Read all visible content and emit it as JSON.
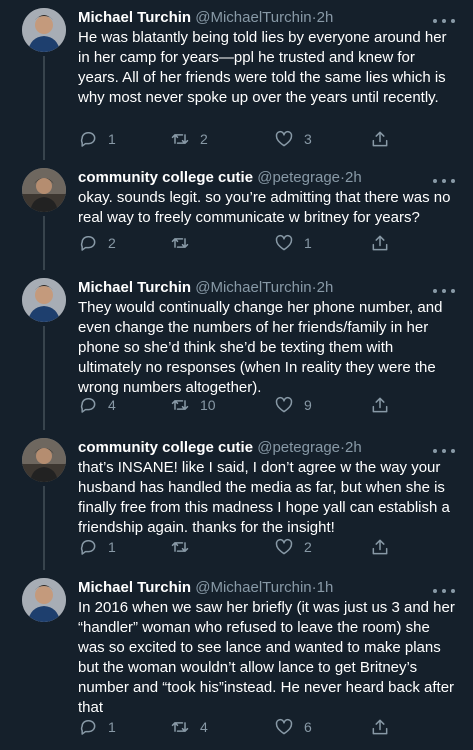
{
  "tweets": [
    {
      "name": "Michael Turchin",
      "handle": "@MichaelTurchin",
      "sep": "·",
      "time": "2h",
      "text": "He was blatantly being told lies by everyone around her in her camp for years—ppl he trusted and knew for years. All of her friends were told the same lies which is why most never spoke up over the years until recently.",
      "replies": "1",
      "retweets": "2",
      "likes": "3"
    },
    {
      "name": "community college cutie",
      "handle": "@petegrage",
      "sep": "·",
      "time": "2h",
      "text": "okay. sounds legit. so you’re admitting that there was no real way to freely communicate w britney for years?",
      "replies": "2",
      "retweets": "",
      "likes": "1"
    },
    {
      "name": "Michael Turchin",
      "handle": "@MichaelTurchin",
      "sep": "·",
      "time": "2h",
      "text": "They would continually change her phone number, and even change the numbers of her friends/family in her phone so she’d think she’d be texting them with ultimately no responses (when In reality they were the wrong numbers altogether).",
      "replies": "4",
      "retweets": "10",
      "likes": "9"
    },
    {
      "name": "community college cutie",
      "handle": "@petegrage",
      "sep": "·",
      "time": "2h",
      "text": "that’s INSANE! like I said, I don’t agree w the way your husband has handled the media as far, but when she is finally free from this madness I hope yall can establish a friendship again. thanks for the insight!",
      "replies": "1",
      "retweets": "",
      "likes": "2"
    },
    {
      "name": "Michael Turchin",
      "handle": "@MichaelTurchin",
      "sep": "·",
      "time": "1h",
      "text": "In 2016 when we saw her briefly (it was just us 3 and her “handler” woman who refused to leave the room) she was so excited to see lance and wanted to make plans but the woman wouldn’t allow lance to get Britney’s number and “took his”instead. He never heard back after that",
      "replies": "1",
      "retweets": "4",
      "likes": "6"
    }
  ],
  "icons": [
    "reply-icon",
    "retweet-icon",
    "like-icon",
    "share-icon",
    "more-options-icon"
  ],
  "colors": {
    "background": "#15202b",
    "secondary_text": "#8899a6",
    "divider": "#38444d"
  }
}
